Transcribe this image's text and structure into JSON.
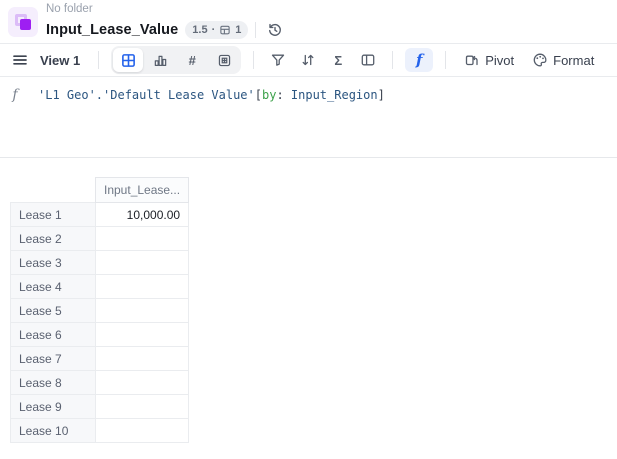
{
  "colors": {
    "accent_blue": "#2563eb",
    "logo_purple": "#9e1ff2",
    "logo_purple_light": "#dcbcf8",
    "logo_bg": "#f5eefd",
    "code_navy": "#2b5580",
    "code_green": "#3da14b",
    "code_dark": "#39404d"
  },
  "header": {
    "folder_label": "No folder",
    "title": "Input_Lease_Value",
    "badge": {
      "version": "1.5",
      "separator": "·",
      "window_count": "1"
    }
  },
  "toolbar": {
    "view_label": "View 1",
    "hash_glyph": "#",
    "sigma_glyph": "Σ",
    "formula_glyph": "f",
    "pivot_label": "Pivot",
    "format_label": "Format"
  },
  "formula": {
    "gutter_glyph": "f",
    "expression": "'L1 Geo'.'Default Lease Value'",
    "open_bracket": "[",
    "by_keyword": "by",
    "colon": ": ",
    "parameter": "Input_Region",
    "close_bracket": "]"
  },
  "table": {
    "value_column_header": "Input_Lease...",
    "rows": [
      {
        "label": "Lease 1",
        "value": "10,000.00"
      },
      {
        "label": "Lease 2",
        "value": ""
      },
      {
        "label": "Lease 3",
        "value": ""
      },
      {
        "label": "Lease 4",
        "value": ""
      },
      {
        "label": "Lease 5",
        "value": ""
      },
      {
        "label": "Lease 6",
        "value": ""
      },
      {
        "label": "Lease 7",
        "value": ""
      },
      {
        "label": "Lease 8",
        "value": ""
      },
      {
        "label": "Lease 9",
        "value": ""
      },
      {
        "label": "Lease 10",
        "value": ""
      }
    ]
  }
}
